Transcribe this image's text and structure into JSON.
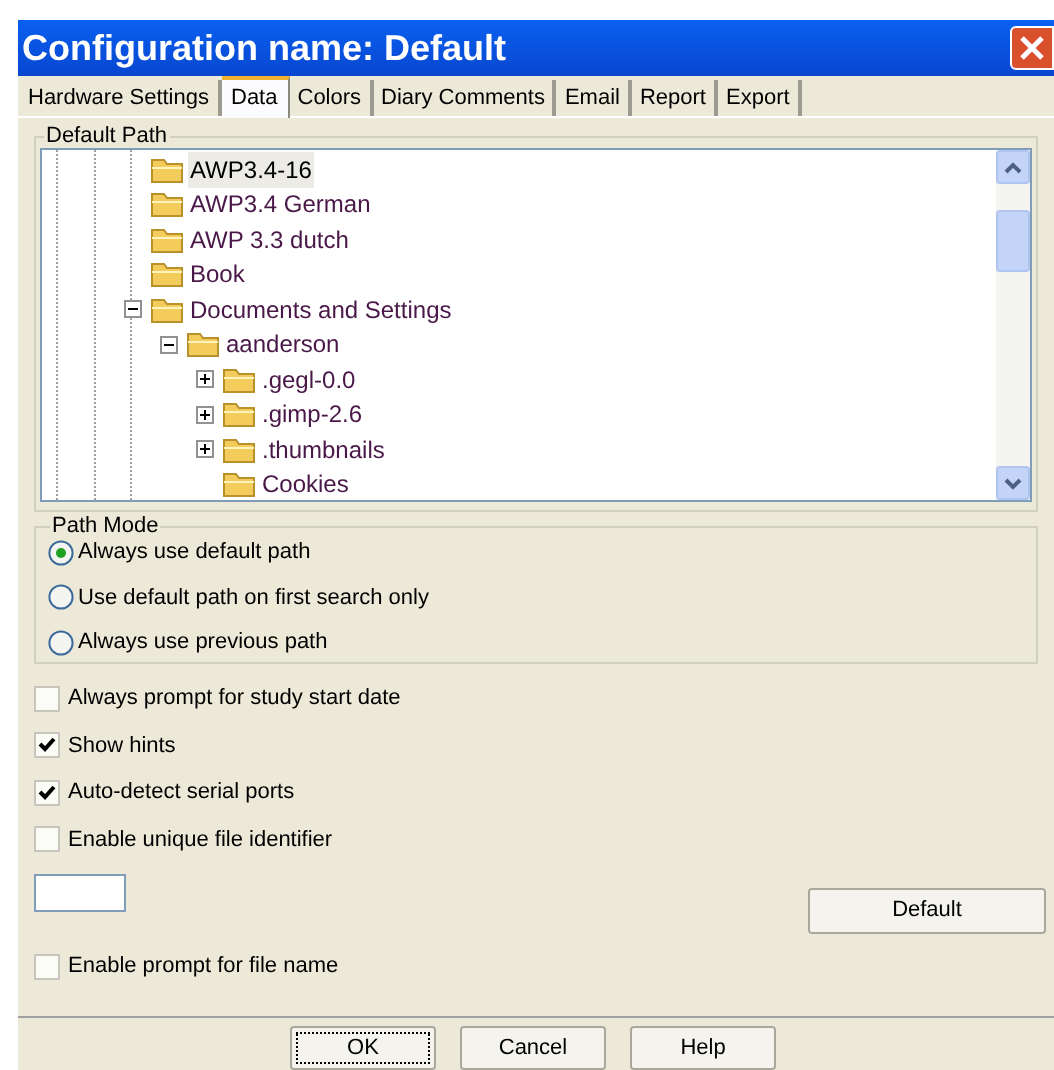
{
  "window": {
    "title": "Configuration name: Default"
  },
  "tabs": [
    {
      "label": "Hardware Settings",
      "selected": false
    },
    {
      "label": "Data",
      "selected": true
    },
    {
      "label": "Colors",
      "selected": false
    },
    {
      "label": "Diary Comments",
      "selected": false
    },
    {
      "label": "Email",
      "selected": false
    },
    {
      "label": "Report",
      "selected": false
    },
    {
      "label": "Export",
      "selected": false
    }
  ],
  "default_path": {
    "label": "Default Path",
    "tree": [
      {
        "label": "AWP3.4-16",
        "selected": true
      },
      {
        "label": "AWP3.4 German",
        "selected": false
      },
      {
        "label": "AWP 3.3 dutch",
        "selected": false
      },
      {
        "label": "Book",
        "selected": false
      },
      {
        "label": "Documents and Settings",
        "selected": false,
        "expanded": true,
        "children": [
          {
            "label": "aanderson",
            "selected": false,
            "expanded": true,
            "children": [
              {
                "label": ".gegl-0.0",
                "selected": false,
                "expanded": false
              },
              {
                "label": ".gimp-2.6",
                "selected": false,
                "expanded": false
              },
              {
                "label": ".thumbnails",
                "selected": false,
                "expanded": false
              },
              {
                "label": "Cookies",
                "selected": false
              }
            ]
          }
        ]
      }
    ]
  },
  "path_mode": {
    "label": "Path Mode",
    "options": [
      {
        "label": "Always use default path",
        "selected": true
      },
      {
        "label": "Use default path on first search only",
        "selected": false
      },
      {
        "label": "Always use previous path",
        "selected": false
      }
    ]
  },
  "options": [
    {
      "label": "Always prompt for study start date",
      "checked": false
    },
    {
      "label": "Show hints",
      "checked": true
    },
    {
      "label": "Auto-detect serial ports",
      "checked": true
    },
    {
      "label": "Enable unique file identifier",
      "checked": false
    }
  ],
  "default_button": "Default",
  "prompt_option": {
    "label": "Enable prompt for file name",
    "checked": false
  },
  "buttons": [
    "OK",
    "Cancel",
    "Help"
  ]
}
